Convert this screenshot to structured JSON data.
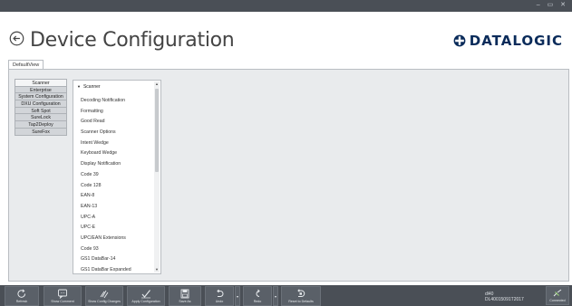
{
  "window": {
    "controls": "– ▭ ✕"
  },
  "header": {
    "title": "Device Configuration",
    "brand": "DATALOGIC"
  },
  "view_tab": "DefaultView",
  "categories": [
    {
      "label": "Scanner",
      "selected": true
    },
    {
      "label": "Enterprise"
    },
    {
      "label": "System Configuration"
    },
    {
      "label": "DXU Configuration"
    },
    {
      "label": "Soft Spot"
    },
    {
      "label": "SureLock"
    },
    {
      "label": "Tap2Deploy"
    },
    {
      "label": "SureFox"
    }
  ],
  "tree": {
    "root": "Scanner",
    "items": [
      "Decoding Notification",
      "Formatting",
      "Good Read",
      "Scanner Options",
      "Intent Wedge",
      "Keyboard Wedge",
      "Display Notification",
      "Code 39",
      "Code 128",
      "EAN-8",
      "EAN-13",
      "UPC-A",
      "UPC-E",
      "UPC/EAN Extensions",
      "Code 93",
      "GS1 DataBar-14",
      "GS1 DataBar Expanded"
    ]
  },
  "toolbar": {
    "refresh": "Refresh",
    "show_comment": "Show Comment",
    "show_changes": "Show Config Changes",
    "apply": "Apply Configuration",
    "save_as": "Save As",
    "undo": "Undo",
    "redo": "Redo",
    "reset": "Reset to Defaults",
    "connected": "Connected"
  },
  "status": {
    "model": "dl40",
    "serial": "DL40015091T2017"
  },
  "icons": {
    "back": "back-arrow-icon",
    "refresh": "refresh-icon",
    "comment": "comment-icon",
    "changes": "changes-icon",
    "apply": "checkmark-icon",
    "save": "save-icon",
    "undo": "undo-icon",
    "redo": "redo-icon",
    "reset": "reset-icon",
    "connected": "connected-icon"
  },
  "colors": {
    "brand": "#0a2b5a",
    "toolbar": "#4a4f56",
    "panel": "#e9ebed"
  }
}
